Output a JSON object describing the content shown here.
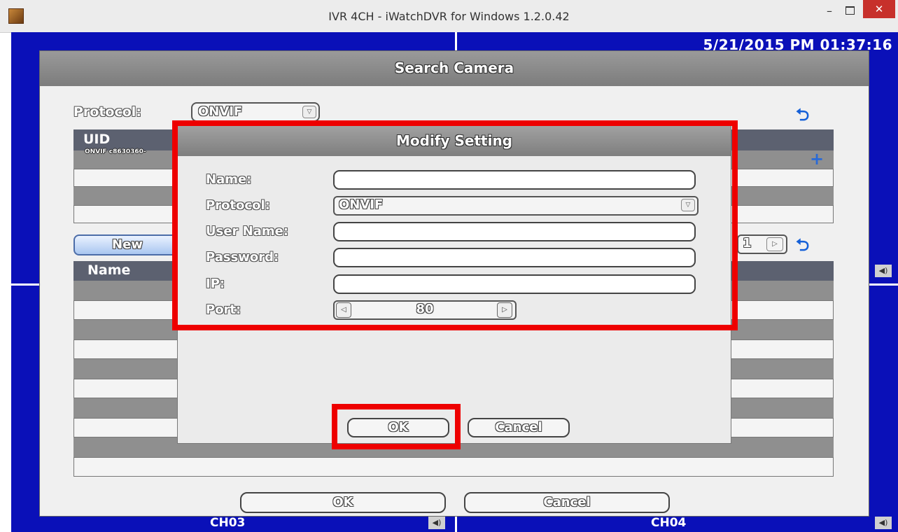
{
  "window": {
    "title": "IVR 4CH - iWatchDVR for Windows 1.2.0.42",
    "min_glyph": "–",
    "close_glyph": "✕"
  },
  "dvr": {
    "timestamp": "5/21/2015 PM 01:37:16",
    "ch03_label": "CH03",
    "ch04_label": "CH04"
  },
  "search_camera": {
    "title": "Search Camera",
    "protocol_label": "Protocol:",
    "protocol_value": "ONVIF",
    "uid_header": "UID",
    "uid_row_text": "ONVIF c8630360-",
    "new_button": "New",
    "page_number": "1",
    "name_header": "Name",
    "ok_button": "OK",
    "cancel_button": "Cancel"
  },
  "modify_setting": {
    "title": "Modify Setting",
    "name_label": "Name:",
    "name_value": "",
    "protocol_label": "Protocol:",
    "protocol_value": "ONVIF",
    "username_label": "User Name:",
    "username_value": "",
    "password_label": "Password:",
    "password_value": "",
    "ip_label": "IP:",
    "ip_value": "",
    "port_label": "Port:",
    "port_value": "80",
    "ok_button": "OK",
    "cancel_button": "Cancel"
  },
  "colors": {
    "highlight": "#ee0000",
    "dvr_background": "#0a10b8",
    "close_button": "#c7302b"
  }
}
